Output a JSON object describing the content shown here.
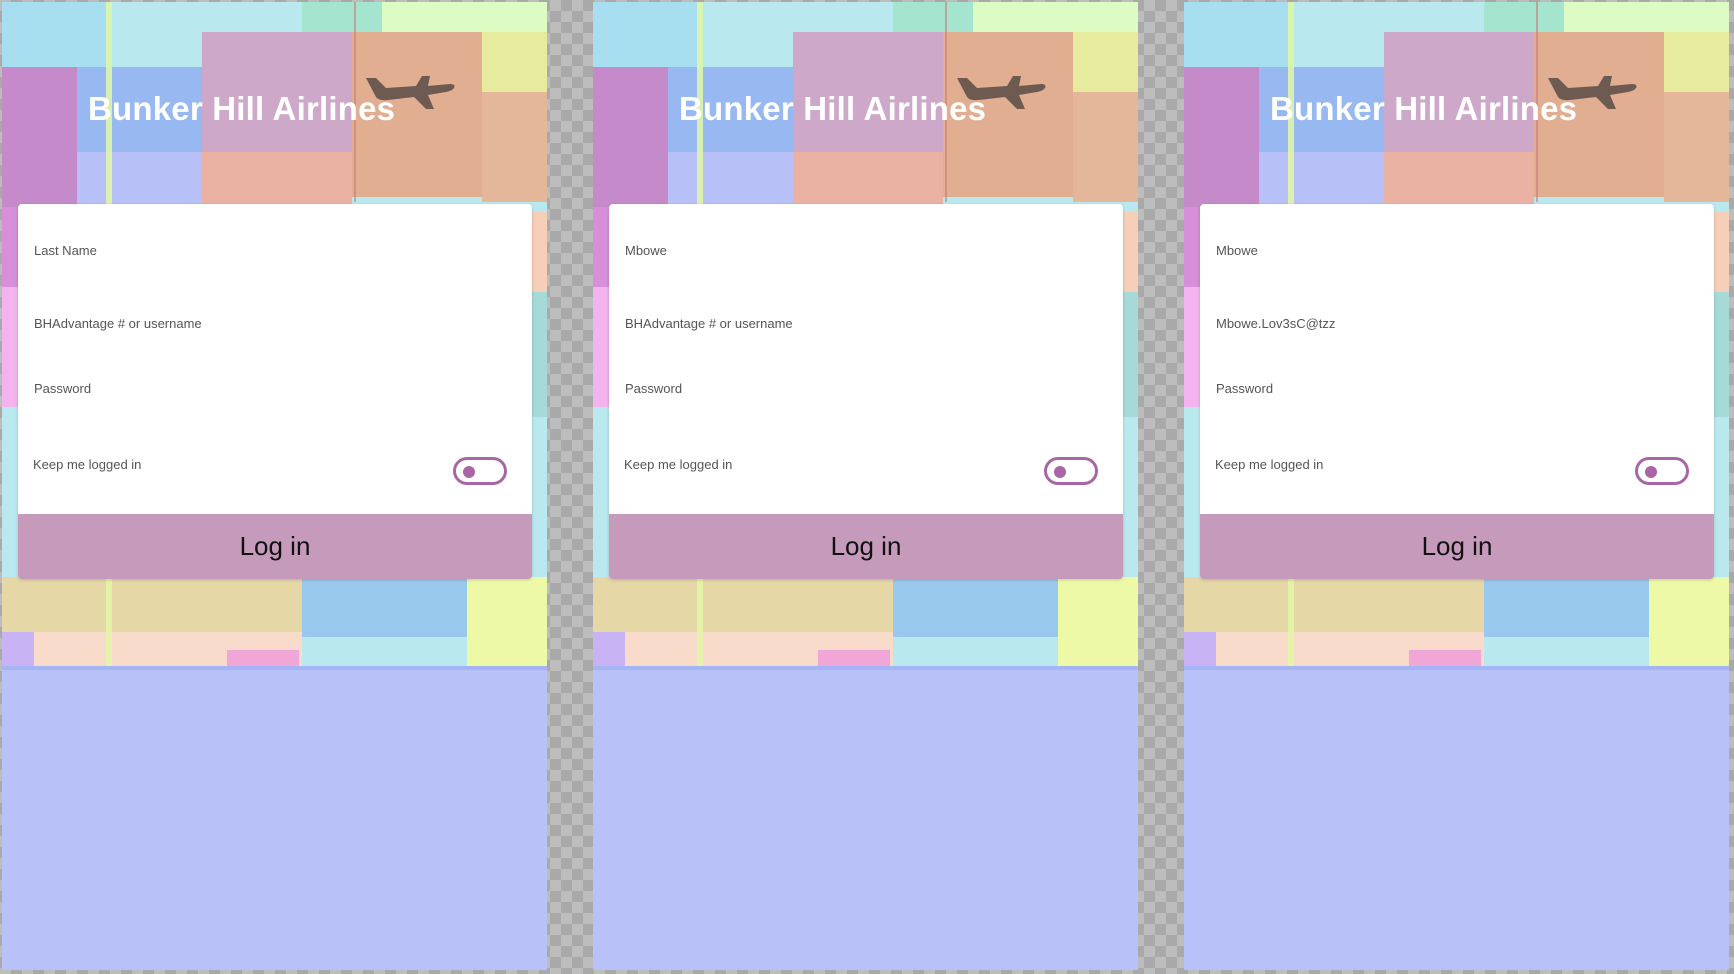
{
  "brand": {
    "name": "Bunker Hill Airlines",
    "logo_icon": "airplane-icon",
    "logo_color": "#6f5a52"
  },
  "colors": {
    "accent": "#a866a4",
    "button_bg": "#c59aba",
    "page_bg": "#b8c2f8"
  },
  "screens": [
    {
      "last_name": {
        "value": "",
        "placeholder": "Last Name"
      },
      "username": {
        "value": "",
        "placeholder": "BHAdvantage # or username"
      },
      "password": {
        "value": "",
        "placeholder": "Password"
      },
      "keep_logged_in": {
        "label": "Keep me logged in",
        "checked": false
      },
      "login_label": "Log in"
    },
    {
      "last_name": {
        "value": "Mbowe",
        "placeholder": "Last Name"
      },
      "username": {
        "value": "",
        "placeholder": "BHAdvantage # or username"
      },
      "password": {
        "value": "",
        "placeholder": "Password"
      },
      "keep_logged_in": {
        "label": "Keep me logged in",
        "checked": false
      },
      "login_label": "Log in"
    },
    {
      "last_name": {
        "value": "Mbowe",
        "placeholder": "Last Name"
      },
      "username": {
        "value": "Mbowe.Lov3sC@tzz",
        "placeholder": "BHAdvantage # or username"
      },
      "password": {
        "value": "",
        "placeholder": "Password"
      },
      "keep_logged_in": {
        "label": "Keep me logged in",
        "checked": false
      },
      "login_label": "Log in"
    }
  ]
}
